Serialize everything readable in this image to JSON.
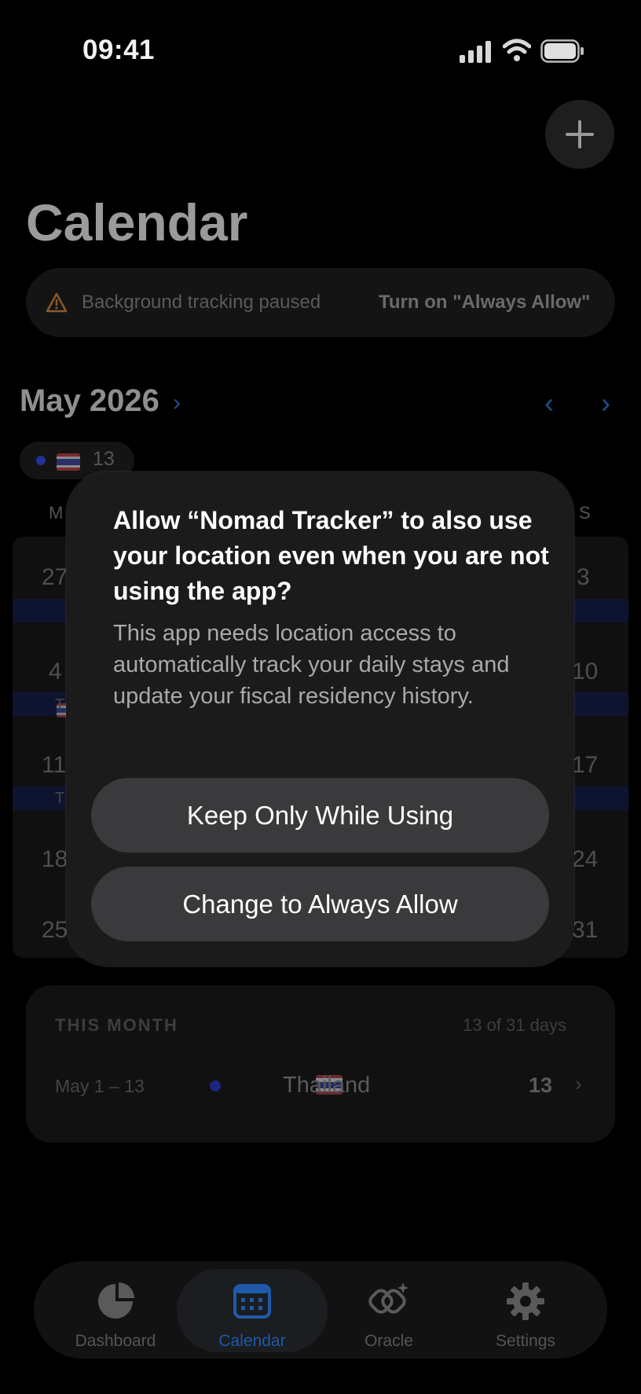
{
  "status_bar": {
    "time": "09:41"
  },
  "header": {
    "title": "Calendar"
  },
  "banner": {
    "message": "Background tracking paused",
    "action": "Turn on \"Always Allow\""
  },
  "calendar": {
    "month_label": "May 2026",
    "chip_count": "13",
    "weekday_left": "M",
    "weekday_right": "S",
    "rows_left": [
      "27",
      "4",
      "11",
      "18",
      "25"
    ],
    "rows_right": [
      "3",
      "10",
      "17",
      "24",
      "31"
    ],
    "row_label_partial": "T"
  },
  "summary": {
    "title": "THIS MONTH",
    "days": "13 of 31 days",
    "range": "May 1 – 13",
    "country": "Thailand",
    "count": "13"
  },
  "tabs": [
    {
      "label": "Dashboard",
      "icon": "pie-chart-icon"
    },
    {
      "label": "Calendar",
      "icon": "calendar-icon"
    },
    {
      "label": "Oracle",
      "icon": "sparkle-link-icon"
    },
    {
      "label": "Settings",
      "icon": "gear-icon"
    }
  ],
  "dialog": {
    "title": "Allow “Nomad Tracker” to also use your location even when you are not using the app?",
    "message": "This app needs location access to automatically track your daily stays and update your fiscal residency history.",
    "button_keep": "Keep Only While Using",
    "button_always": "Change to Always Allow"
  },
  "colors": {
    "accent": "#1f6fd6",
    "thai_red": "#a52a32",
    "thai_blue": "#27307a"
  }
}
